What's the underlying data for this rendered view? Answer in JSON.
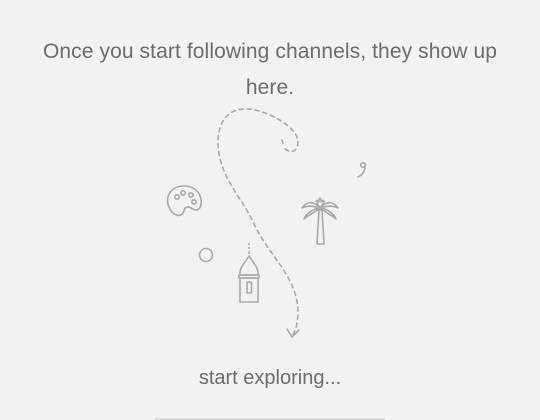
{
  "empty_state": {
    "message": "Once you start following channels, they show up here.",
    "cta_label": "start exploring...",
    "illustration_icons": [
      "palette-icon",
      "palm-tree-icon",
      "tower-icon",
      "circle-icon",
      "comma-icon",
      "dashed-arrow-icon"
    ]
  },
  "colors": {
    "background": "#f2f2f2",
    "text": "#6c6c6c",
    "illustration_stroke": "#a9a9a9"
  }
}
